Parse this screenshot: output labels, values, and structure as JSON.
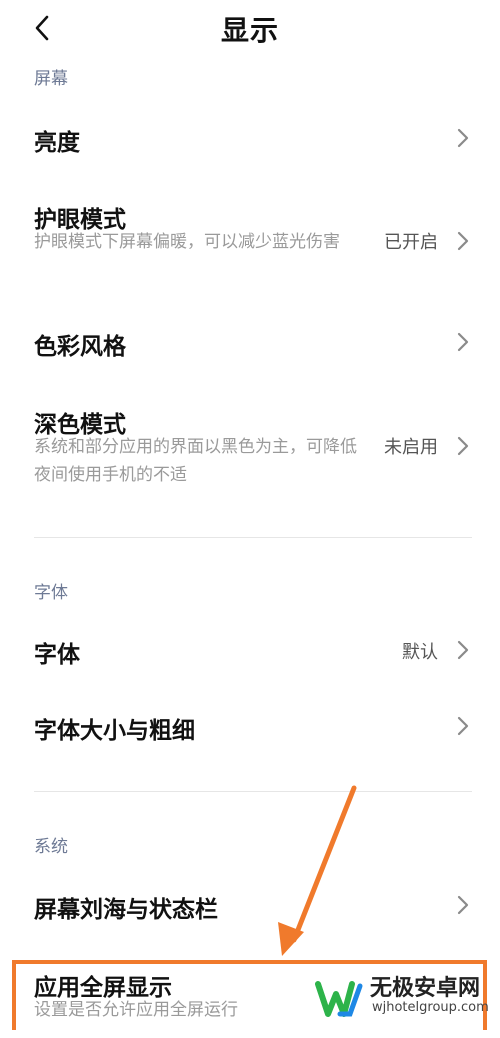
{
  "header": {
    "title": "显示",
    "back_icon": "chevron-left-icon"
  },
  "sections": {
    "screen": {
      "label": "屏幕",
      "items": {
        "brightness": {
          "title": "亮度"
        },
        "eye_care": {
          "title": "护眼模式",
          "subtitle": "护眼模式下屏幕偏暖，可以减少蓝光伤害",
          "value": "已开启"
        },
        "color_style": {
          "title": "色彩风格"
        },
        "dark_mode": {
          "title": "深色模式",
          "subtitle": "系统和部分应用的界面以黑色为主，可降低夜间使用手机的不适",
          "value": "未启用"
        }
      }
    },
    "font": {
      "label": "字体",
      "items": {
        "font": {
          "title": "字体",
          "value": "默认"
        },
        "font_size": {
          "title": "字体大小与粗细"
        }
      }
    },
    "system": {
      "label": "系统",
      "items": {
        "notch": {
          "title": "屏幕刘海与状态栏"
        },
        "fullscreen": {
          "title": "应用全屏显示",
          "subtitle": "设置是否允许应用全屏运行"
        }
      }
    }
  },
  "annotation": {
    "highlight_color": "#f07a2c"
  },
  "watermark": {
    "name": "无极安卓网",
    "url": "wjhotelgroup.com",
    "logo_colors": [
      "#2db34a",
      "#1e88e5"
    ]
  }
}
